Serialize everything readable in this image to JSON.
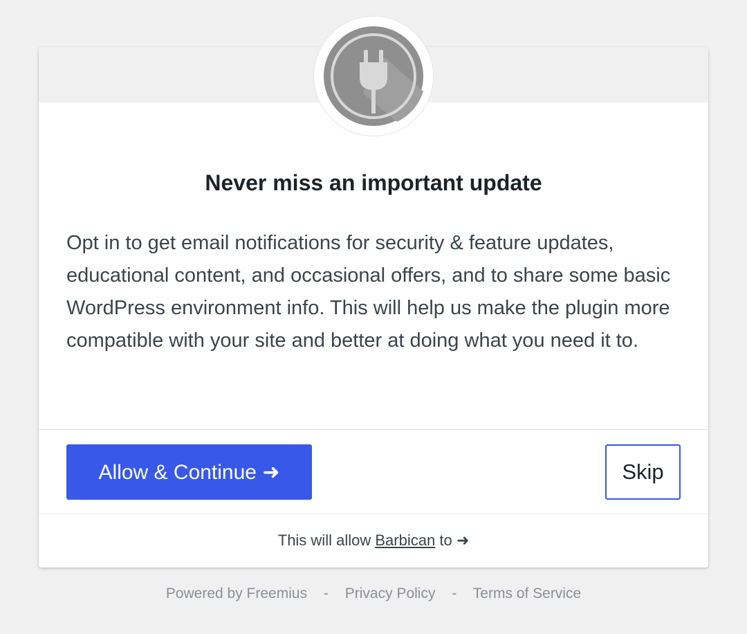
{
  "dialog": {
    "title": "Never miss an important update",
    "description": "Opt in to get email notifications for security & feature updates, educational content, and occasional offers, and to share some basic WordPress environment info. This will help us make the plugin more compatible with your site and better at doing what you need it to.",
    "logo_icon": "plug-icon",
    "allow_label": "Allow & Continue ➜",
    "skip_label": "Skip",
    "permissions": {
      "prefix": "This will allow",
      "plugin_name": "Barbican",
      "suffix": "to",
      "arrow": "➜"
    }
  },
  "footer": {
    "powered_by": "Powered by Freemius",
    "separator": "-",
    "privacy": "Privacy Policy",
    "terms": "Terms of Service"
  },
  "colors": {
    "accent": "#3858e9",
    "background": "#f0f0f1",
    "header": "#f0f0f0",
    "logo_gray": "#8f8f8f"
  }
}
